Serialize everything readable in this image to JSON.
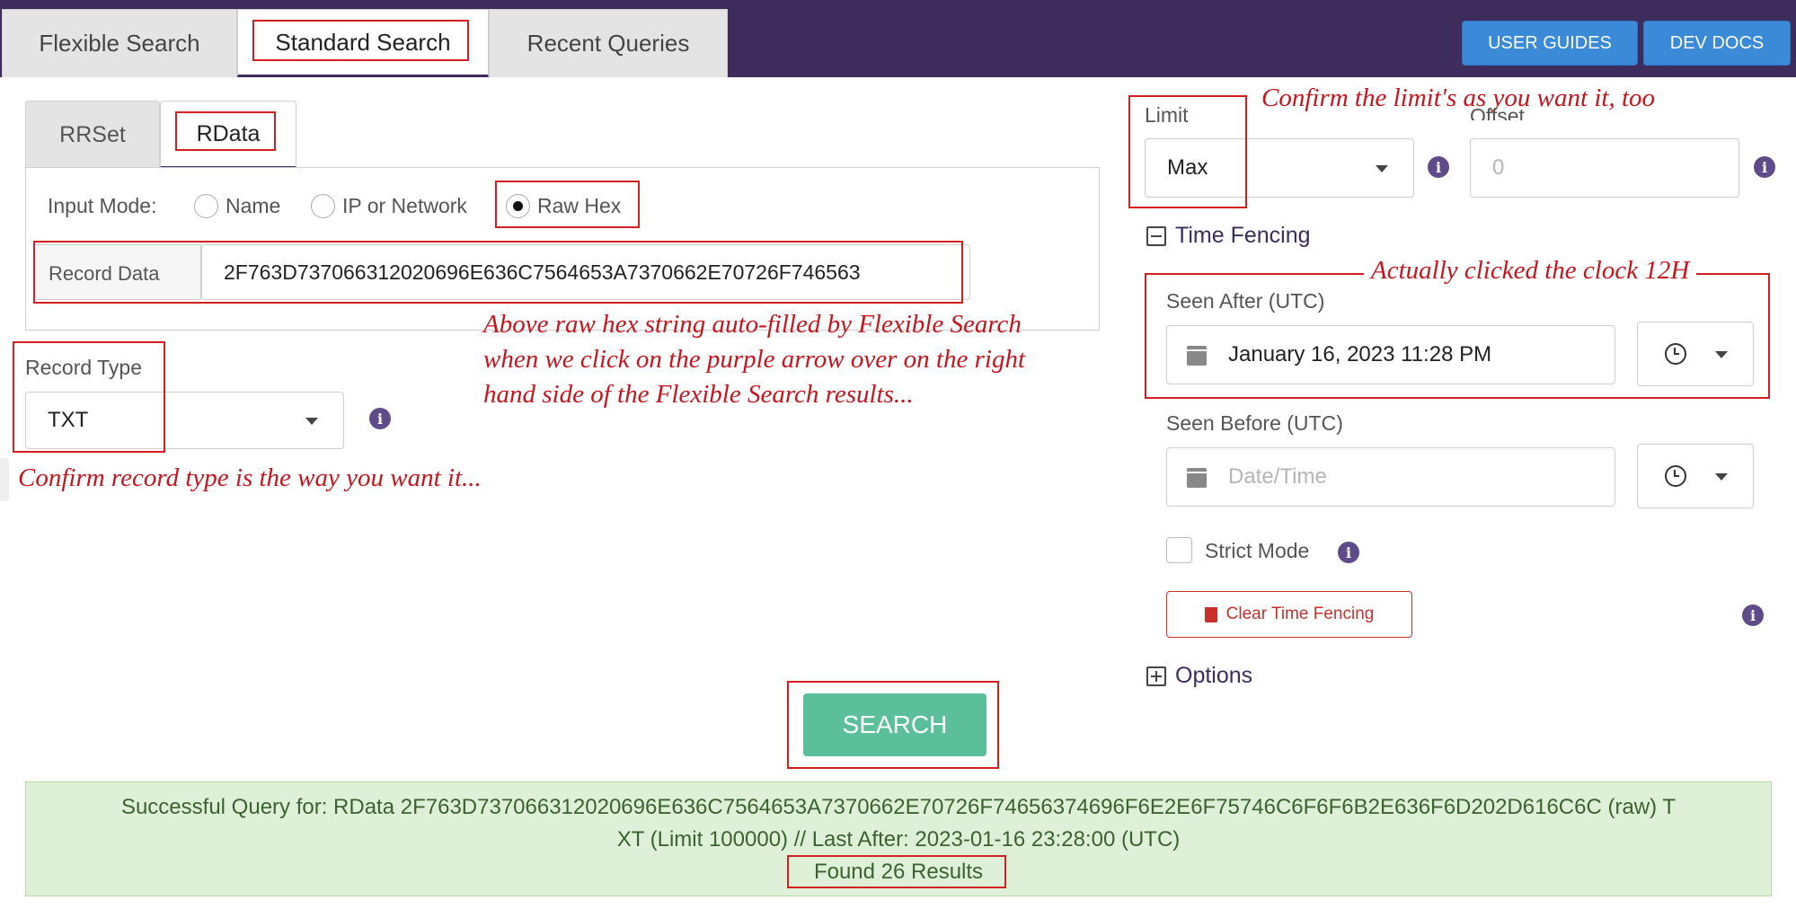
{
  "tabs": {
    "flexible": "Flexible Search",
    "standard": "Standard Search",
    "recent": "Recent Queries"
  },
  "header_buttons": {
    "user_guides": "USER GUIDES",
    "dev_docs": "DEV DOCS"
  },
  "subtabs": {
    "rrset": "RRSet",
    "rdata": "RData"
  },
  "input_mode": {
    "label": "Input Mode:",
    "options": [
      "Name",
      "IP or Network",
      "Raw Hex"
    ],
    "selected": "Raw Hex"
  },
  "record_data": {
    "label": "Record Data",
    "value": "2F763D737066312020696E636C7564653A7370662E70726F746563"
  },
  "record_type": {
    "label": "Record Type",
    "value": "TXT"
  },
  "limit": {
    "label": "Limit",
    "value": "Max"
  },
  "offset": {
    "label": "Offset",
    "placeholder": "0"
  },
  "time_fencing": {
    "title": "Time Fencing",
    "seen_after_label": "Seen After (UTC)",
    "seen_after_value": "January 16, 2023 11:28 PM",
    "seen_before_label": "Seen Before (UTC)",
    "seen_before_placeholder": "Date/Time",
    "strict_mode": "Strict Mode",
    "clear_button": "Clear Time Fencing"
  },
  "options_label": "Options",
  "search_button": "SEARCH",
  "result": {
    "line1": "Successful Query for: RData 2F763D737066312020696E636C7564653A7370662E70726F74656374696F6E2E6F75746C6F6F6B2E636F6D202D616C6C (raw) T",
    "line2": "XT (Limit 100000) // Last After: 2023-01-16 23:28:00 (UTC)",
    "found": "Found 26 Results"
  },
  "annotations": {
    "limit_note": "Confirm the limit's as you want it, too",
    "clock_note": "Actually clicked the clock 12H",
    "hex_note_1": "Above raw hex string auto-filled by Flexible Search",
    "hex_note_2": "when we click on the purple arrow over on the right",
    "hex_note_3": "hand side of the Flexible Search results...",
    "record_type_note": "Confirm record type is the way you want it..."
  },
  "colors": {
    "header": "#3d2c5c",
    "accent_button": "#3a8ad8",
    "search_button": "#5bbf9b",
    "annotation": "#c8141c",
    "success_bg": "#dff0d8"
  }
}
